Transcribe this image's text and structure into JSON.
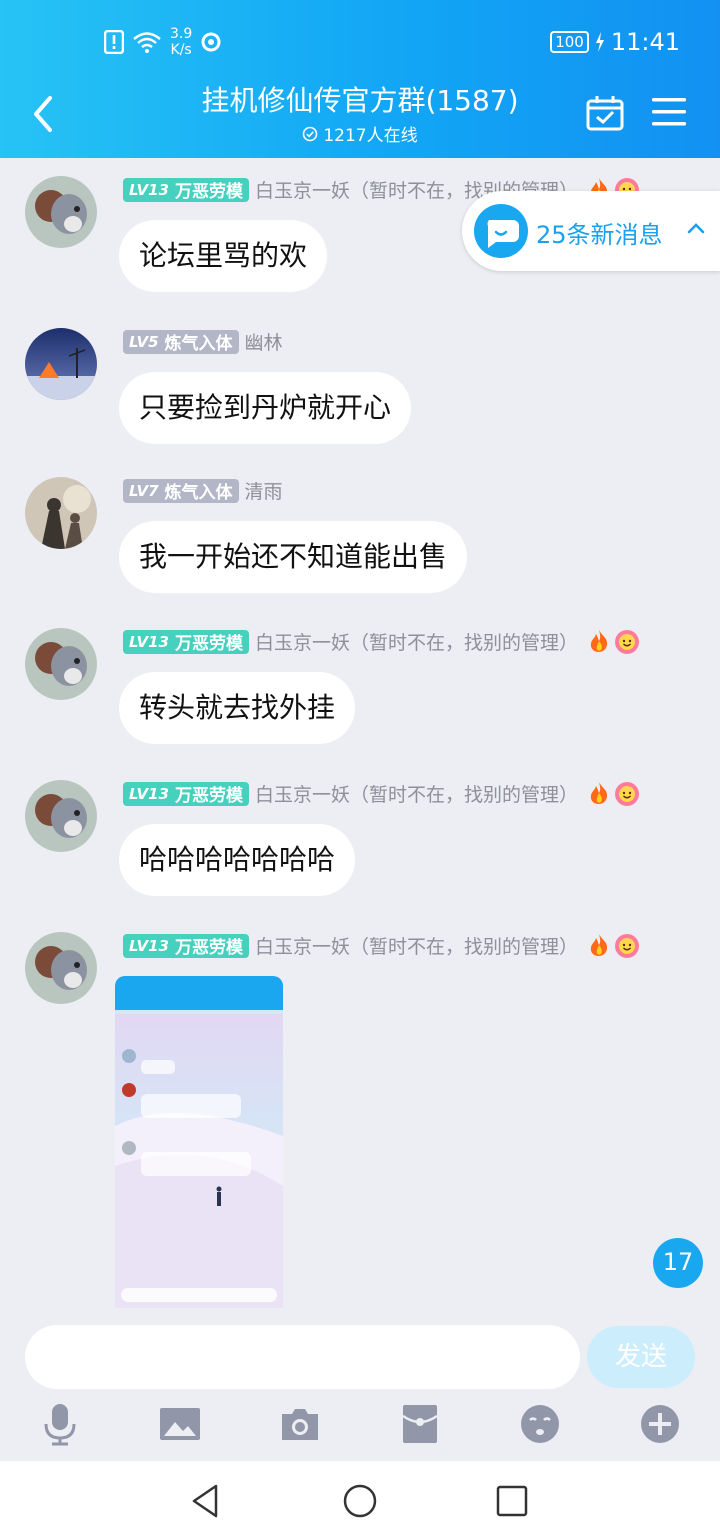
{
  "status_bar": {
    "speed_value": "3.9",
    "speed_unit": "K/s",
    "battery": "100",
    "time": "11:41"
  },
  "header": {
    "title": "挂机修仙传官方群(1587)",
    "online": "1217人在线"
  },
  "new_messages": {
    "label": "25条新消息"
  },
  "messages": [
    {
      "lv": "LV13",
      "rank": "万恶劳模",
      "user": "白玉京一妖（暂时不在，找别的管理）",
      "text": "论坛里骂的欢"
    },
    {
      "lv": "LV5",
      "rank": "炼气入体",
      "user": "幽林",
      "text": "只要捡到丹炉就开心"
    },
    {
      "lv": "LV7",
      "rank": "炼气入体",
      "user": "清雨",
      "text": "我一开始还不知道能出售"
    },
    {
      "lv": "LV13",
      "rank": "万恶劳模",
      "user": "白玉京一妖（暂时不在，找别的管理）",
      "text": "转头就去找外挂"
    },
    {
      "lv": "LV13",
      "rank": "万恶劳模",
      "user": "白玉京一妖（暂时不在，找别的管理）",
      "text": "哈哈哈哈哈哈哈"
    },
    {
      "lv": "LV13",
      "rank": "万恶劳模",
      "user": "白玉京一妖（暂时不在，找别的管理）"
    }
  ],
  "unread_badge": "17",
  "composer": {
    "placeholder": "",
    "send_label": "发送"
  },
  "colors": {
    "accent": "#12a6f5",
    "level_badge_high": "#45d1bd",
    "level_badge_low": "#b3b6c6",
    "chat_bg": "#eceef4"
  },
  "toolbar_icons": [
    "microphone-icon",
    "picture-icon",
    "camera-icon",
    "red-packet-icon",
    "emoji-icon",
    "plus-icon"
  ],
  "nav_icons": [
    "back-triangle-icon",
    "home-circle-icon",
    "recents-square-icon"
  ]
}
